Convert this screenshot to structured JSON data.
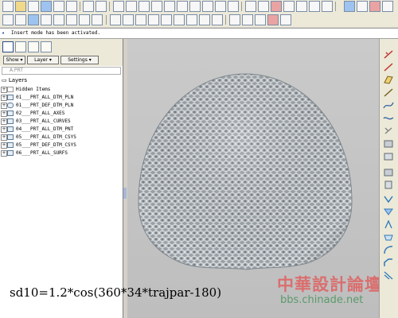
{
  "message": {
    "text": "Insert mode has been activated."
  },
  "panel": {
    "dropdowns": [
      "Show",
      "Layer",
      "Settings"
    ],
    "part_name": "A.PRT",
    "tree_header": "Layers",
    "layers": [
      "Hidden Items",
      "01___PRT_ALL_DTM_PLN",
      "01___PRT_DEF_DTM_PLN",
      "02___PRT_ALL_AXES",
      "03___PRT_ALL_CURVES",
      "04___PRT_ALL_DTM_PNT",
      "05___PRT_ALL_DTM_CSYS",
      "05___PRT_DEF_DTM_CSYS",
      "06___PRT_ALL_SURFS"
    ]
  },
  "viewport": {
    "formula": "sd10=1.2*cos(360*34*trajpar-180)",
    "watermark_title": "中華設計論壇",
    "watermark_url": "bbs.chinade.net"
  },
  "colors": {
    "accent": "#2c4a88",
    "model_fill": "#a9b0b6",
    "model_shade": "#6f777e",
    "watermark": "#e06060"
  }
}
